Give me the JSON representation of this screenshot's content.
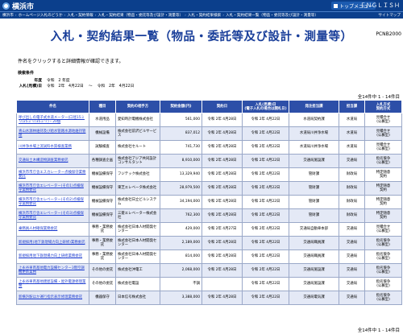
{
  "header": {
    "site_name": "横浜市",
    "top_menu": "トップメニュー",
    "lang": "ＥＮＧＬＩＳＨ"
  },
  "breadcrumb": {
    "items": [
      "横浜市",
      "ホームページ入札のどうか",
      "入札・契約情報",
      "入札・契約結果（物品・委託等及び設計・測量等）",
      "入札・契約結果検索",
      "入札・契約結果一覧（物品・委託等及び設計・測量等）"
    ],
    "sitemap": "サイトマップ"
  },
  "page": {
    "title": "入札・契約結果一覧（物品・委託等及び設計・測量等）",
    "code": "PCNB2000",
    "instruction": "件名をクリックすると詳細情報が確認できます。",
    "conditions_heading": "検索条件",
    "conditions": {
      "year_label": "年度",
      "year_value": "令和　2 年度",
      "date_label": "入札(見積)日",
      "date_from": "令和　2年　4月22日",
      "date_sep": "～",
      "date_to": "令和　2年　4月22日"
    },
    "count_top": "全14件中 1 - 14件目",
    "count_bottom": "全14件中 1 - 14件目"
  },
  "table": {
    "columns": [
      "件名",
      "種目",
      "契約の相手方",
      "契約金額(円)",
      "契約日",
      "入札(見積)日\n(電子入札の場合は開札日)",
      "発注担当課",
      "担当課",
      "入札方式\n契約方式"
    ],
    "rows": [
      {
        "name": "呼び出しの電子式水道メーター(口径15ミリ/25ミリ/35ミリ)・20個",
        "type": "水道用品",
        "vendor": "愛知時計電機株式会社",
        "amount": "561,000",
        "contract_date": "令和 2年 4月28日",
        "bid_date": "令和 2年 4月22日",
        "dept": "水道局契約課",
        "section": "水道局",
        "method": "見積合せ\n(公募型)"
      },
      {
        "name": "青山水源林維持及び給水管路水源地維持管理",
        "type": "機械設備",
        "vendor": "株式会社前沢ビルサービス",
        "amount": "837,012",
        "contract_date": "令和 2年 4月28日",
        "bid_date": "令和 2年 4月22日",
        "dept": "水道局川井浄水場",
        "section": "水道局",
        "method": "見積合せ\n(公募型)"
      },
      {
        "name": "川井浄水場上流試料水質検査業務",
        "type": "試験検査",
        "vendor": "株式会社セルート",
        "amount": "741,730",
        "contract_date": "令和 2年 4月28日",
        "bid_date": "令和 2年 4月22日",
        "dept": "水道局川井浄水場",
        "section": "水道局",
        "method": "見積合せ\n(公募型)"
      },
      {
        "name": "交通局土木構造物調査業務委託",
        "type": "各種調査企画",
        "vendor": "株式会社アジア共同設計コンサルタント",
        "amount": "8,910,000",
        "contract_date": "令和 2年 4月28日",
        "bid_date": "令和 2年 4月22日",
        "dept": "交通局施設課",
        "section": "交通局",
        "method": "指名競争\n(公募型)"
      },
      {
        "name": "横浜市市庁舎エスカレーター点検保守業務委託",
        "type": "機械設備保守",
        "vendor": "フジテック株式会社",
        "amount": "13,329,940",
        "contract_date": "令和 2年 4月28日",
        "bid_date": "令和 2年 4月22日",
        "dept": "管財課",
        "section": "財政局",
        "method": "特定随意\n契約"
      },
      {
        "name": "横浜市市庁舎エレベーター(その1)点検保守業務委託",
        "type": "機械設備保守",
        "vendor": "東芝エレベータ株式会社",
        "amount": "28,979,500",
        "contract_date": "令和 2年 4月28日",
        "bid_date": "令和 2年 4月22日",
        "dept": "管財課",
        "section": "財政局",
        "method": "特定随意\n契約"
      },
      {
        "name": "横浜市市庁舎エレベーター(その2)点検保守業務委託",
        "type": "機械設備保守",
        "vendor": "株式会社日立ビルシステム",
        "amount": "34,194,000",
        "contract_date": "令和 2年 4月28日",
        "bid_date": "令和 2年 4月22日",
        "dept": "管財課",
        "section": "財政局",
        "method": "特定随意\n契約"
      },
      {
        "name": "横浜市市庁舎エレベーター(その3)点検保守業務委託",
        "type": "機械設備保守",
        "vendor": "三菱エレベーター株式会社",
        "amount": "762,300",
        "contract_date": "令和 2年 4月28日",
        "bid_date": "令和 2年 4月22日",
        "dept": "管財課",
        "section": "財政局",
        "method": "特定随意\n契約"
      },
      {
        "name": "乗務員人材確保業務委託",
        "type": "事務・業務委託",
        "vendor": "株式会社日本人材開発センター",
        "amount": "429,000",
        "contract_date": "令和 2年 4月27日",
        "bid_date": "令和 2年 4月22日",
        "dept": "交通局自動車本部",
        "section": "交通局",
        "method": "見積合せ\n(公募型)"
      },
      {
        "name": "新規採用(地下鉄現場力向上研修)業務委託",
        "type": "事務・業務委託",
        "vendor": "株式会社日本人材開発センター",
        "amount": "2,189,000",
        "contract_date": "令和 2年 4月28日",
        "bid_date": "令和 2年 4月22日",
        "dept": "交通局職員課",
        "section": "交通局",
        "method": "指名競争\n(公募型)"
      },
      {
        "name": "新規採用地下鉄現場力向上研修業務委託",
        "type": "事務・業務委託",
        "vendor": "株式会社日本人材開発センター",
        "amount": "814,000",
        "contract_date": "令和 2年 4月28日",
        "bid_date": "令和 2年 4月22日",
        "dept": "交通局職員課",
        "section": "交通局",
        "method": "指名競争\n(公募型)"
      },
      {
        "name": "上永谷車両基地電力設備センター3階空調機更新業務",
        "type": "その他の委託",
        "vendor": "株式会社沖電工",
        "amount": "2,068,000",
        "contract_date": "令和 2年 4月28日",
        "bid_date": "令和 2年 4月22日",
        "dept": "交通局施設課",
        "section": "交通局",
        "method": "指名競争\n(公募型)"
      },
      {
        "name": "上永谷車両基地建屋設備・屋外電源修理業務",
        "type": "その他の委託",
        "vendor": "株式会社電設",
        "amount": "不調",
        "contract_date": "",
        "bid_date": "令和 2年 4月22日",
        "dept": "交通局施設課",
        "section": "交通局",
        "method": "指名競争\n(公募型)"
      },
      {
        "name": "新横浜駅ほか運行指示表示修理業務委託",
        "type": "機器保守",
        "vendor": "日本信号株式会社",
        "amount": "3,388,000",
        "contract_date": "令和 2年 4月28日",
        "bid_date": "令和 2年 4月22日",
        "dept": "交通局電気課",
        "section": "交通局",
        "method": "指名競争\n(公募型)"
      }
    ]
  },
  "colors": {
    "header_bg": "#0b3f8c",
    "table_header": "#2d4fa8",
    "title": "#1a3f9a",
    "link": "#1f3ed0"
  }
}
